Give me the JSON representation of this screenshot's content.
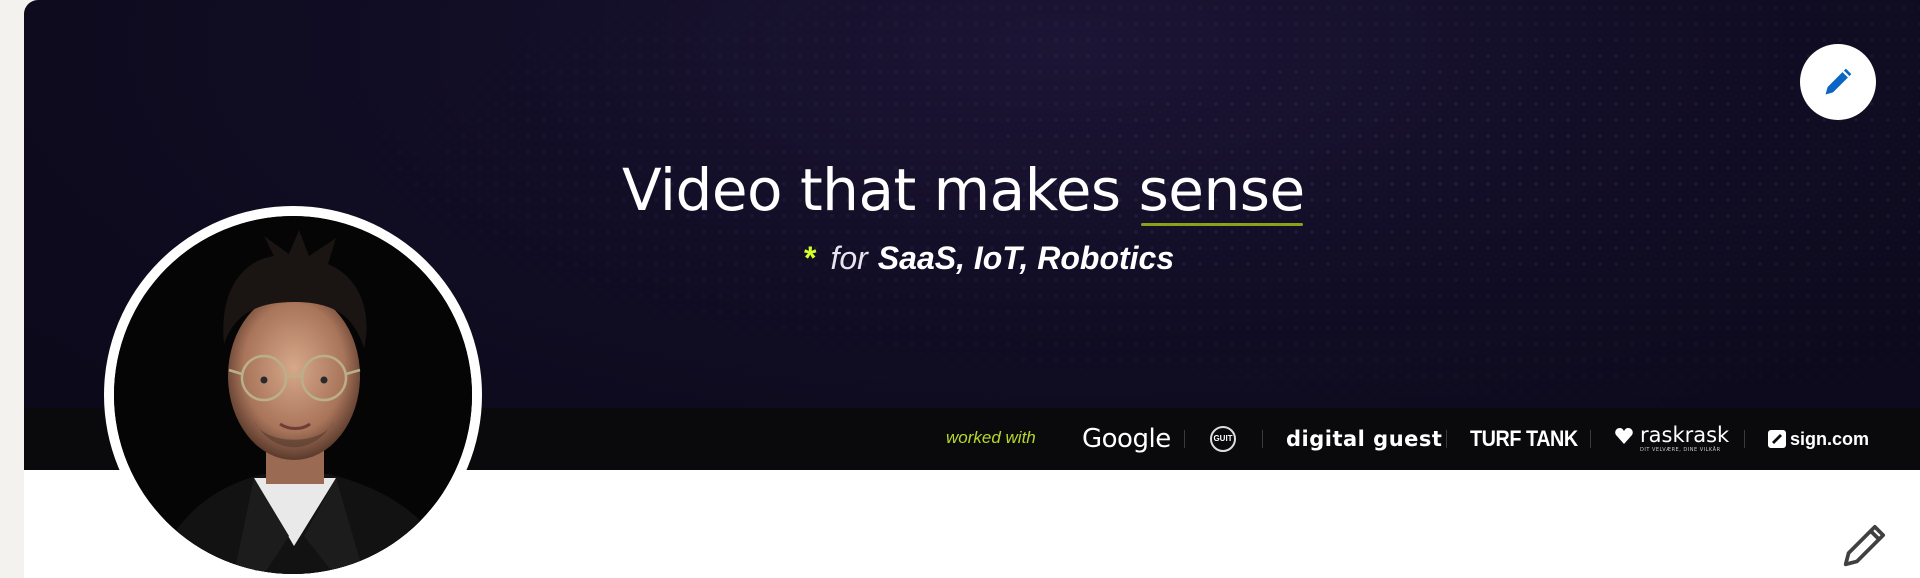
{
  "banner": {
    "headline_prefix": "Video that makes",
    "headline_highlight": "sense",
    "sub_star": "*",
    "sub_for": "for",
    "sub_targets": "SaaS, IoT, Robotics",
    "logos": {
      "worked_with": "worked with",
      "google": "Google",
      "deskseal": "GUIT",
      "digital_guest": "digital guest",
      "turf_tank": "TURF TANK",
      "raskrask": "raskrask",
      "raskrask_tagline": "DIT VELVÆRE, DINE VILKÅR",
      "sign": "sign.com"
    },
    "edit_icon": "pencil-icon"
  },
  "profile": {
    "avatar_icon": "profile-photo",
    "edit_icon": "pencil-icon"
  },
  "colors": {
    "accent_lime": "#d4ff2a",
    "edit_blue": "#0a66c2",
    "banner_bg": "#110d24"
  }
}
